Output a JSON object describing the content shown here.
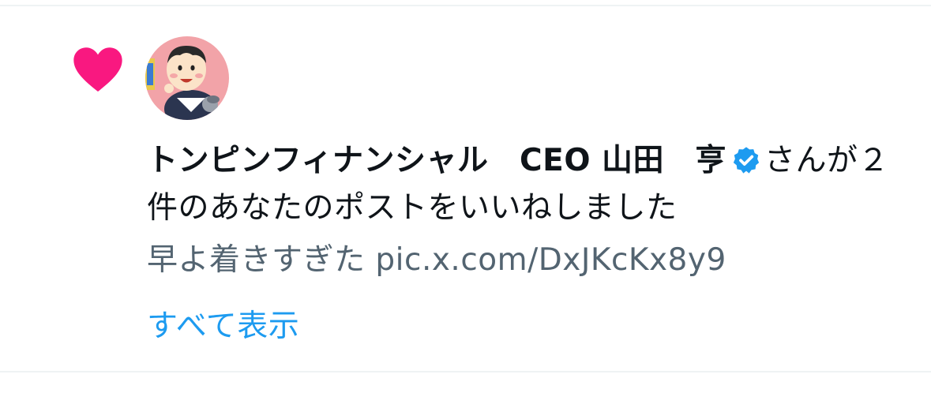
{
  "notification": {
    "icon": "heart-icon",
    "avatar_icon": "user-avatar-illustration",
    "user_name": "トンピンフィナンシャル　CEO 山田　亨",
    "verified_icon": "verified-badge-icon",
    "action_text": "さんが２件のあなたのポストをいいねしました",
    "post_preview_text": "早よ着きすぎた",
    "post_preview_link": "pic.x.com/DxJKcKx8y9",
    "show_all_label": "すべて表示"
  },
  "colors": {
    "heart": "#f91880",
    "verified": "#1d9bf0",
    "link": "#1d9bf0",
    "primary_text": "#0f1419",
    "secondary_text": "#536471",
    "divider": "#eff3f4",
    "avatar_bg": "#f0a0a6"
  }
}
